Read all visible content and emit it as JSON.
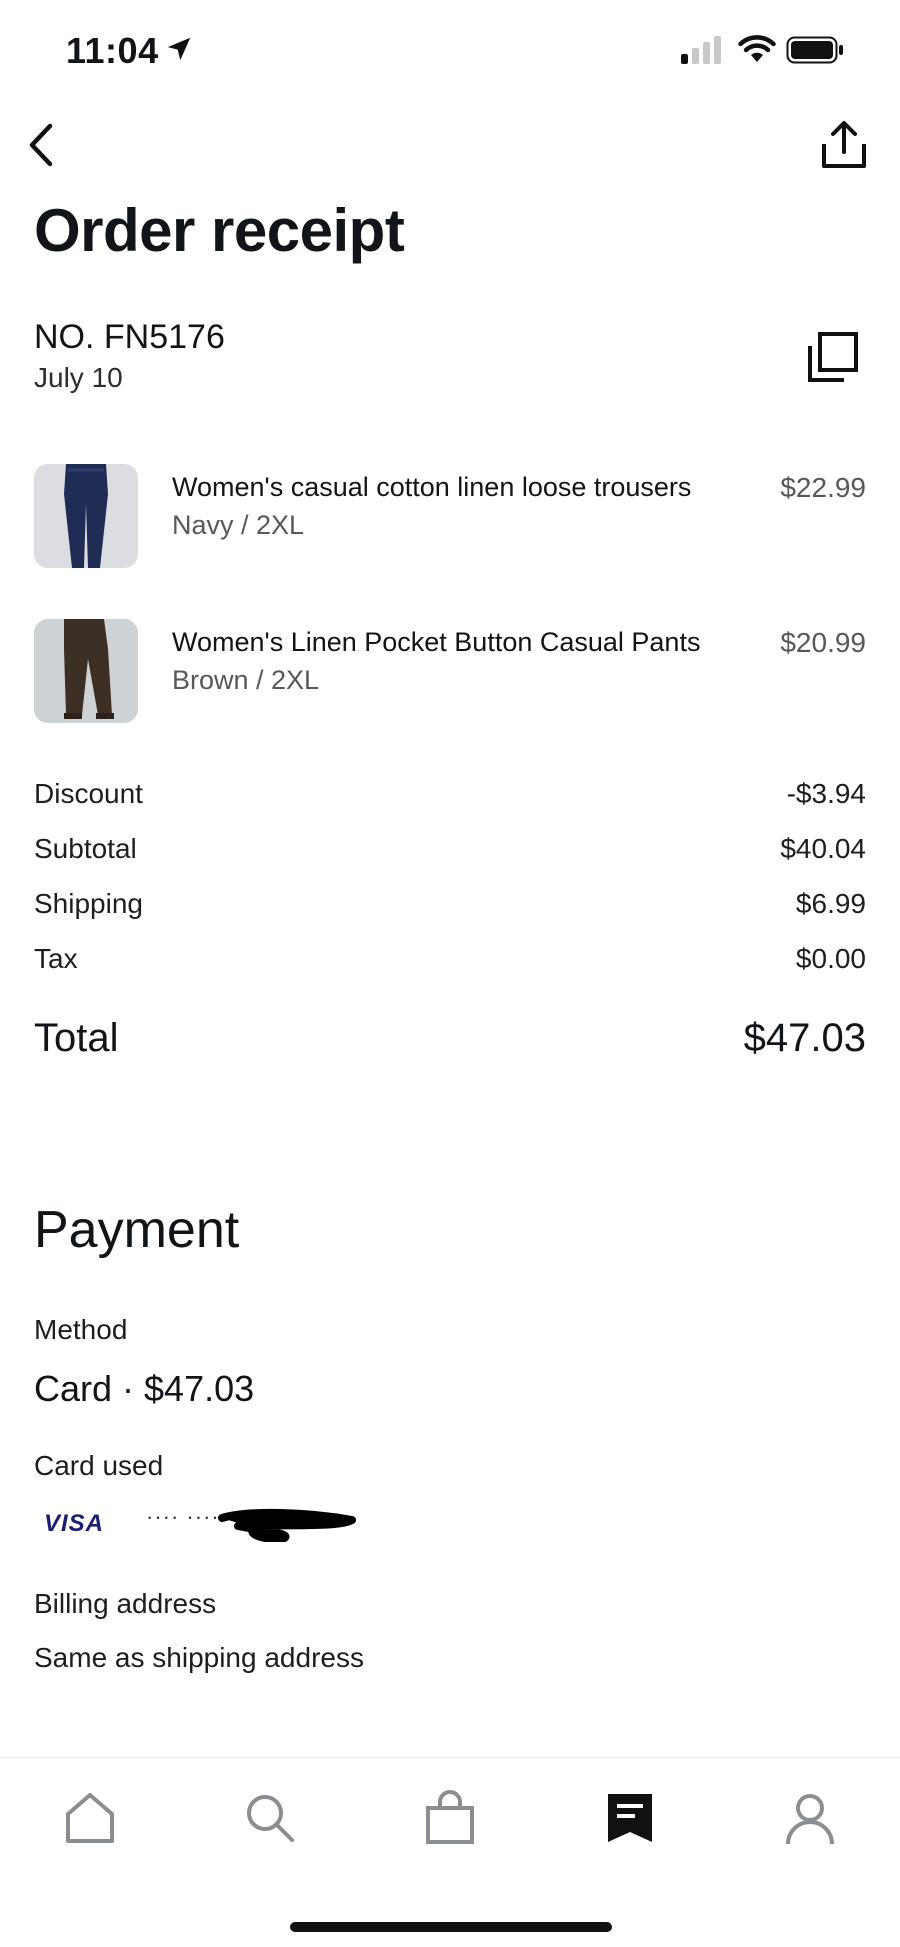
{
  "status_bar": {
    "time": "11:04"
  },
  "header": {
    "title": "Order receipt",
    "back_icon": "chevron-left-icon",
    "share_icon": "share-icon"
  },
  "order": {
    "number": "NO. FN5176",
    "date": "July 10",
    "copy_icon": "copy-icon"
  },
  "items": [
    {
      "title": "Women's casual cotton linen loose trousers",
      "variant": "Navy / 2XL",
      "price": "$22.99",
      "thumb_color": "#1f2d55"
    },
    {
      "title": "Women's Linen Pocket Button Casual Pants",
      "variant": "Brown / 2XL",
      "price": "$20.99",
      "thumb_color": "#3b2f26"
    }
  ],
  "summary": {
    "discount_label": "Discount",
    "discount_value": "-$3.94",
    "subtotal_label": "Subtotal",
    "subtotal_value": "$40.04",
    "shipping_label": "Shipping",
    "shipping_value": "$6.99",
    "tax_label": "Tax",
    "tax_value": "$0.00",
    "total_label": "Total",
    "total_value": "$47.03"
  },
  "payment": {
    "heading": "Payment",
    "method_label": "Method",
    "method_value": "Card · $47.03",
    "card_used_label": "Card used",
    "card_brand": "VISA",
    "card_masked": "···· ···· ····",
    "billing_label": "Billing address",
    "billing_value": "Same as shipping address"
  },
  "tab_bar": {
    "tabs": [
      {
        "icon": "home-icon",
        "active": false
      },
      {
        "icon": "search-icon",
        "active": false
      },
      {
        "icon": "shopping-bag-icon",
        "active": false
      },
      {
        "icon": "receipt-icon",
        "active": true
      },
      {
        "icon": "profile-icon",
        "active": false
      }
    ]
  },
  "colors": {
    "text_primary": "#111418",
    "text_secondary": "#55595e",
    "visa_blue": "#1a1f71"
  }
}
